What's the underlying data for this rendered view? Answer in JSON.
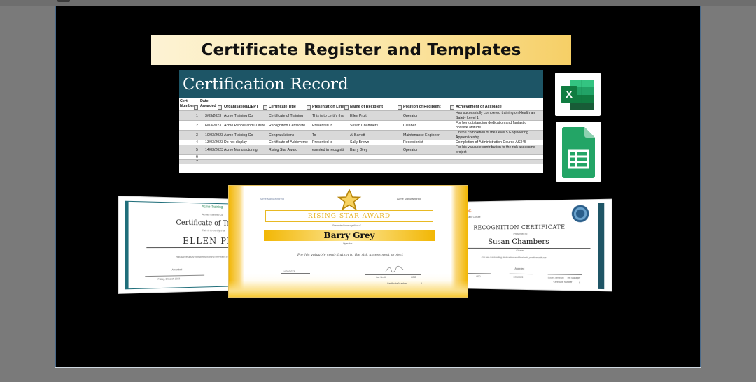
{
  "title": "Certificate Register and Templates",
  "sheet": {
    "heading": "Certification Record",
    "columns": [
      "Cert Number",
      "Date Awarded",
      "Organisation/DEPT",
      "Certificate Title",
      "Presentation Line",
      "Name of Recipient",
      "Position of Recipient",
      "Achievement or Accolade"
    ],
    "rows": [
      {
        "n": "1",
        "date": "3/03/2023",
        "org": "Acme Training Co",
        "title": "Certificate of Training",
        "line": "This is to certify that",
        "name": "Ellen Pruitt",
        "pos": "Operator",
        "ach1": "Has successfully completed  training on Health an",
        "ach2": "Safety Level 1"
      },
      {
        "n": "2",
        "date": "6/03/2023",
        "org": "Acme People and Culture",
        "title": "Recognition Certificate",
        "line": "Presented to",
        "name": "Susan Chambers",
        "pos": "Cleaner",
        "ach1": "For her outstanding dedication and fantastic",
        "ach2": "positive attitude"
      },
      {
        "n": "3",
        "date": "10/03/2023",
        "org": "Acme Training Co",
        "title": "Congratulations",
        "line": "To",
        "name": "Al Barrett",
        "pos": "Maintenance Engineer",
        "ach1": "On the completion of the Level 5 Engineering",
        "ach2": "Apprenticeship"
      },
      {
        "n": "4",
        "date": "13/03/2023",
        "org": "Do not display",
        "title": "Certificate of Achieveme",
        "line": "Presented to",
        "name": "Sally Brown",
        "pos": "Receptionist",
        "ach1": "Completion of Administration Course AS345",
        "ach2": ""
      },
      {
        "n": "5",
        "date": "14/03/2023",
        "org": "Acme Manufacturing",
        "title": "Rising Star Award",
        "line": "esented in recogniti",
        "name": "Barry Grey",
        "pos": "Operator",
        "ach1": "For his valuable contribution to the risk assessme",
        "ach2": "project"
      },
      {
        "n": "6"
      },
      {
        "n": "7"
      }
    ]
  },
  "icons": [
    "excel-icon",
    "google-sheets-icon"
  ],
  "cert_left": {
    "org": "Acme Training",
    "org2": "Acme Training Co",
    "heading": "Certificate of Trai",
    "line": "This is to certify that",
    "name": "ELLEN PRUI",
    "text": "Has successfully completed training on Health and",
    "label": "Awarded",
    "date": "Friday, 3 March 2023"
  },
  "cert_mid": {
    "org_left": "Acme Manufacturing",
    "org_right": "Acme Manufacturing",
    "heading": "RISING STAR AWARD",
    "line": "Presented in recognition of",
    "name": "Barry Grey",
    "position": "Operator",
    "text": "For his valuable contribution to the risk assessment project",
    "date": "14/03/2023",
    "signer": "Joe Smith",
    "signer_title": "CEO",
    "cert_no_label": "Certificate Number",
    "cert_no": "5"
  },
  "cert_right": {
    "brand": "p&c",
    "org": "People and Culture",
    "heading": "RECOGNITION CERTIFICATE",
    "line": "Presented to",
    "name": "Susan Chambers",
    "position": "Cleaner",
    "text": "For her outstanding dedication and fantastic positive attitude",
    "label": "Awarded",
    "date": "6/03/2023",
    "sig_left": "CEO",
    "sig_name": "Susan Jameson",
    "sig_title": "HR Manager",
    "cert_no_label": "Certificate Number",
    "cert_no": "2"
  },
  "colors": {
    "banner_light": "#fdf3d4",
    "banner_dark": "#f6cf66",
    "sheet_header": "#1d5566",
    "gold": "#f5c518",
    "teal": "#1f6e7a"
  }
}
